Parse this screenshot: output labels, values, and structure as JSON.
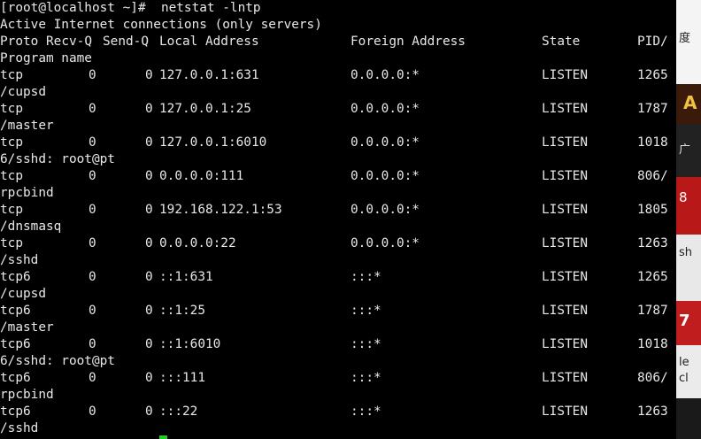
{
  "terminal": {
    "prompt": "[root@localhost ~]#  netstat -lntp",
    "banner": "Active Internet connections (only servers)",
    "headers": {
      "proto": "Proto",
      "recvq": "Recv-Q",
      "sendq": "Send-Q",
      "local": "Local Address",
      "foreign": "Foreign Address",
      "state": "State",
      "pid": "PID/",
      "program_name": "Program name"
    },
    "rows": [
      {
        "proto": "tcp",
        "recvq": "0",
        "sendq": "0",
        "local": "127.0.0.1:631",
        "foreign": "0.0.0.0:*",
        "state": "LISTEN",
        "pid": "1265",
        "wrap": "/cupsd"
      },
      {
        "proto": "tcp",
        "recvq": "0",
        "sendq": "0",
        "local": "127.0.0.1:25",
        "foreign": "0.0.0.0:*",
        "state": "LISTEN",
        "pid": "1787",
        "wrap": "/master"
      },
      {
        "proto": "tcp",
        "recvq": "0",
        "sendq": "0",
        "local": "127.0.0.1:6010",
        "foreign": "0.0.0.0:*",
        "state": "LISTEN",
        "pid": "1018",
        "wrap": "6/sshd: root@pt"
      },
      {
        "proto": "tcp",
        "recvq": "0",
        "sendq": "0",
        "local": "0.0.0.0:111",
        "foreign": "0.0.0.0:*",
        "state": "LISTEN",
        "pid": "806/",
        "wrap": "rpcbind"
      },
      {
        "proto": "tcp",
        "recvq": "0",
        "sendq": "0",
        "local": "192.168.122.1:53",
        "foreign": "0.0.0.0:*",
        "state": "LISTEN",
        "pid": "1805",
        "wrap": "/dnsmasq"
      },
      {
        "proto": "tcp",
        "recvq": "0",
        "sendq": "0",
        "local": "0.0.0.0:22",
        "foreign": "0.0.0.0:*",
        "state": "LISTEN",
        "pid": "1263",
        "wrap": "/sshd"
      },
      {
        "proto": "tcp6",
        "recvq": "0",
        "sendq": "0",
        "local": "::1:631",
        "foreign": ":::*",
        "state": "LISTEN",
        "pid": "1265",
        "wrap": "/cupsd"
      },
      {
        "proto": "tcp6",
        "recvq": "0",
        "sendq": "0",
        "local": "::1:25",
        "foreign": ":::*",
        "state": "LISTEN",
        "pid": "1787",
        "wrap": "/master"
      },
      {
        "proto": "tcp6",
        "recvq": "0",
        "sendq": "0",
        "local": "::1:6010",
        "foreign": ":::*",
        "state": "LISTEN",
        "pid": "1018",
        "wrap": "6/sshd: root@pt"
      },
      {
        "proto": "tcp6",
        "recvq": "0",
        "sendq": "0",
        "local": ":::111",
        "foreign": ":::*",
        "state": "LISTEN",
        "pid": "806/",
        "wrap": "rpcbind"
      },
      {
        "proto": "tcp6",
        "recvq": "0",
        "sendq": "0",
        "local": ":::22",
        "foreign": ":::*",
        "state": "LISTEN",
        "pid": "1263",
        "wrap": "/sshd"
      }
    ],
    "colors": {
      "background": "#000000",
      "text": "#e8e8e8",
      "cursor": "#22cc22"
    }
  },
  "background_window": {
    "fragments": [
      "度",
      "A",
      "广",
      "8",
      "sh",
      "7",
      "le",
      "cl"
    ]
  }
}
